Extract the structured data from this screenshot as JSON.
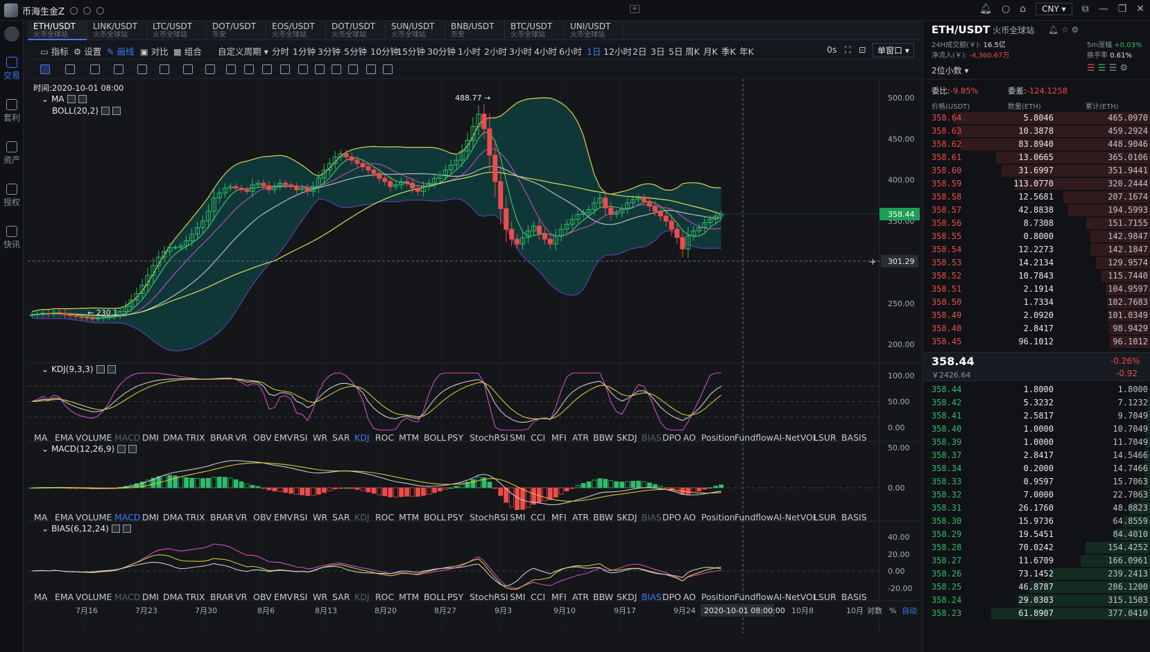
{
  "app": {
    "user_name": "币海生金Z",
    "currency": "CNY"
  },
  "nav": [
    {
      "label": "交易",
      "active": true
    },
    {
      "label": "套利",
      "active": false
    },
    {
      "label": "资产",
      "active": false
    },
    {
      "label": "授权",
      "active": false
    },
    {
      "label": "快讯",
      "active": false
    }
  ],
  "tabs": [
    {
      "pair": "ETH/USDT",
      "exchange": "火币全球站"
    },
    {
      "pair": "LINK/USDT",
      "exchange": "火币全球站"
    },
    {
      "pair": "LTC/USDT",
      "exchange": "火币全球站"
    },
    {
      "pair": "DOT/USDT",
      "exchange": "币安"
    },
    {
      "pair": "EOS/USDT",
      "exchange": "火币全球站"
    },
    {
      "pair": "DOT/USDT",
      "exchange": "火币全球站"
    },
    {
      "pair": "SUN/USDT",
      "exchange": "火币全球站"
    },
    {
      "pair": "BNB/USDT",
      "exchange": "币安"
    },
    {
      "pair": "BTC/USDT",
      "exchange": "火币全球站"
    },
    {
      "pair": "UNI/USDT",
      "exchange": "火币全球站"
    }
  ],
  "toolbar": {
    "indicator": "指标",
    "settings": "设置",
    "draw": "画线",
    "compare": "对比",
    "combine": "组合",
    "custom_period": "自定义周期",
    "periods": [
      "分时",
      "1分钟",
      "3分钟",
      "5分钟",
      "10分钟",
      "15分钟",
      "30分钟",
      "1小时",
      "2小时",
      "3小时",
      "4小时",
      "6小时",
      "1日",
      "12小时",
      "2日",
      "3日",
      "5日",
      "周K",
      "月K",
      "季K",
      "年K"
    ],
    "selected_period": "1日",
    "timer": "0s",
    "window_mode": "单窗口"
  },
  "chart_info": {
    "time_label": "时间:2020-10-01 08:00",
    "ma_label": "MA",
    "boll_label": "BOLL(20,2)",
    "kdj_label": "KDJ(9,3,3)",
    "macd_label": "MACD(12,26,9)",
    "bias_label": "BIAS(6,12,24)",
    "high_marker": "488.77 →",
    "low_marker": "← 230.1",
    "current_price_tag": "358.44",
    "crosshair_price_tag": "301.29",
    "crosshair_time": "2020-10-01 08:00:00"
  },
  "indicator_bar": [
    "MA",
    "EMA",
    "VOLUME",
    "MACD",
    "DMI",
    "DMA",
    "TRIX",
    "BRAR",
    "VR",
    "OBV",
    "EMV",
    "RSI",
    "WR",
    "SAR",
    "KDJ",
    "ROC",
    "MTM",
    "BOLL",
    "PSY",
    "StochRSI",
    "SMI",
    "CCI",
    "MFI",
    "ATR",
    "BBW",
    "SKDJ",
    "BIAS",
    "DPO",
    "AO",
    "Position",
    "Fundflow",
    "AI-NetVOL",
    "LSUR",
    "BASIS"
  ],
  "xaxis": {
    "labels": [
      "7月16",
      "7月23",
      "7月30",
      "8月6",
      "8月13",
      "8月20",
      "8月27",
      "9月3",
      "9月10",
      "9月17",
      "9月24",
      "2020-10-01 08:00:00",
      "10月8",
      "10月"
    ],
    "right_controls": [
      "对数",
      "%",
      "自动"
    ]
  },
  "yaxis": {
    "main": [
      "500.00",
      "450.00",
      "400.00",
      "350.00",
      "250.00",
      "200.00"
    ],
    "kdj": [
      "100.00",
      "50.00",
      "0.00"
    ],
    "macd": [
      "50.00",
      "0.00"
    ],
    "bias": [
      "40.00",
      "20.00",
      "0.00",
      "-20.00"
    ]
  },
  "chart_data": {
    "type": "candlestick",
    "price_range": [
      190,
      510
    ],
    "candles_close": [
      236,
      237,
      238,
      237,
      239,
      238,
      236,
      235,
      234,
      233,
      232,
      231,
      232,
      233,
      234,
      236,
      240,
      246,
      254,
      262,
      272,
      284,
      296,
      306,
      313,
      318,
      318,
      320,
      326,
      334,
      342,
      350,
      362,
      378,
      384,
      390,
      392,
      390,
      388,
      386,
      394,
      396,
      393,
      388,
      392,
      396,
      394,
      392,
      388,
      390,
      386,
      392,
      402,
      412,
      420,
      428,
      432,
      428,
      424,
      420,
      416,
      412,
      408,
      402,
      398,
      392,
      394,
      398,
      396,
      390,
      386,
      392,
      396,
      402,
      406,
      412,
      418,
      424,
      435,
      448,
      465,
      480,
      462,
      430,
      398,
      365,
      340,
      328,
      322,
      330,
      338,
      344,
      335,
      328,
      322,
      332,
      340,
      346,
      352,
      358,
      360,
      364,
      372,
      378,
      366,
      358,
      360,
      365,
      372,
      376,
      378,
      374,
      368,
      362,
      356,
      350,
      340,
      330,
      316,
      332,
      338,
      342,
      348,
      352,
      356,
      358.44
    ],
    "kdj": {
      "k_range": [
        0,
        100
      ]
    },
    "annotations": {
      "high": 488.77,
      "low": 230.1,
      "last": 358.44
    }
  },
  "right_panel": {
    "pair": "ETH/USDT",
    "exchange": "火币全球站",
    "vol_label": "24H成交额(￥):",
    "vol_value": "16.5亿",
    "inflow_label": "净流入(￥):",
    "inflow_value": "-4,360.67万",
    "change5m_label": "5m涨幅",
    "change5m_value": "+0.03%",
    "turnover_label": "换手率",
    "turnover_value": "0.61%",
    "decimals": "2位小数",
    "weibi_label": "委比:",
    "weibi_value": "-9.85%",
    "weicha_label": "委差:",
    "weicha_value": "-124.1258",
    "col_price": "价格(USDT)",
    "col_amount": "数量(ETH)",
    "col_total": "累计(ETH)",
    "asks": [
      [
        "358.64",
        "5.8046",
        "465.0970"
      ],
      [
        "358.63",
        "10.3878",
        "459.2924"
      ],
      [
        "358.62",
        "83.8940",
        "448.9046"
      ],
      [
        "358.61",
        "13.0665",
        "365.0106"
      ],
      [
        "358.60",
        "31.6997",
        "351.9441"
      ],
      [
        "358.59",
        "113.0770",
        "320.2444"
      ],
      [
        "358.58",
        "12.5681",
        "207.1674"
      ],
      [
        "358.57",
        "42.8838",
        "194.5993"
      ],
      [
        "358.56",
        "8.7308",
        "151.7155"
      ],
      [
        "358.55",
        "0.8000",
        "142.9847"
      ],
      [
        "358.54",
        "12.2273",
        "142.1847"
      ],
      [
        "358.53",
        "14.2134",
        "129.9574"
      ],
      [
        "358.52",
        "10.7843",
        "115.7440"
      ],
      [
        "358.51",
        "2.1914",
        "104.9597"
      ],
      [
        "358.50",
        "1.7334",
        "102.7683"
      ],
      [
        "358.49",
        "2.0920",
        "101.0349"
      ],
      [
        "358.48",
        "2.8417",
        "98.9429"
      ],
      [
        "358.45",
        "96.1012",
        "96.1012"
      ]
    ],
    "last_price": "358.44",
    "last_cny": "￥2426.64",
    "last_change_pct": "-0.26%",
    "last_change": "-0.92",
    "bids": [
      [
        "358.44",
        "1.8000",
        "1.8000"
      ],
      [
        "358.42",
        "5.3232",
        "7.1232"
      ],
      [
        "358.41",
        "2.5817",
        "9.7049"
      ],
      [
        "358.40",
        "1.0000",
        "10.7049"
      ],
      [
        "358.39",
        "1.0000",
        "11.7049"
      ],
      [
        "358.37",
        "2.8417",
        "14.5466"
      ],
      [
        "358.34",
        "0.2000",
        "14.7466"
      ],
      [
        "358.33",
        "0.9597",
        "15.7063"
      ],
      [
        "358.32",
        "7.0000",
        "22.7063"
      ],
      [
        "358.31",
        "26.1760",
        "48.8823"
      ],
      [
        "358.30",
        "15.9736",
        "64.8559"
      ],
      [
        "358.29",
        "19.5451",
        "84.4010"
      ],
      [
        "358.28",
        "70.0242",
        "154.4252"
      ],
      [
        "358.27",
        "11.6709",
        "166.0961"
      ],
      [
        "358.26",
        "73.1452",
        "239.2413"
      ],
      [
        "358.25",
        "46.8787",
        "286.1200"
      ],
      [
        "358.24",
        "29.0303",
        "315.1503"
      ],
      [
        "358.23",
        "61.8907",
        "377.0410"
      ]
    ]
  },
  "colors": {
    "up": "#2ebd6b",
    "down": "#ef4b4b",
    "accent": "#3d7bff",
    "boll_fill": "#0f3b3c"
  }
}
